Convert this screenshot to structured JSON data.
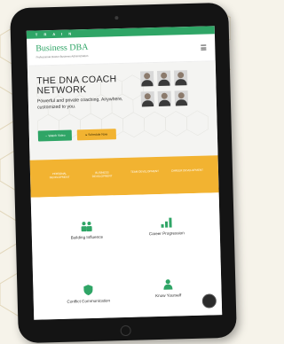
{
  "site": {
    "topbar_text": "T R A I N",
    "logo": "Business DBA",
    "tagline": "Professional Doctor Business Administration"
  },
  "hero": {
    "title": "THE DNA COACH NETWORK",
    "subtitle": "Powerful and private coaching. Anywhere, customized to you.",
    "btn_primary": "→ Watch Video",
    "btn_secondary": "▸ Schedule Now"
  },
  "band": {
    "items": [
      "Personal Development",
      "Business Development",
      "Team Development",
      "Career Development"
    ]
  },
  "services": [
    {
      "label": "Building Influence",
      "icon": "people-icon"
    },
    {
      "label": "Career Progression",
      "icon": "bar-chart-icon"
    },
    {
      "label": "Conflict Communication",
      "icon": "shield-icon"
    },
    {
      "label": "Know Yourself",
      "icon": "person-icon"
    }
  ],
  "colors": {
    "brand_green": "#2fa566",
    "accent_orange": "#f2b331",
    "frame": "#141414"
  }
}
